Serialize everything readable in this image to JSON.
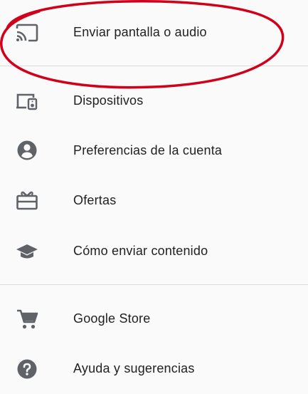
{
  "menu": {
    "items": [
      {
        "label": "Enviar pantalla o audio",
        "icon": "cast-icon"
      },
      {
        "label": "Dispositivos",
        "icon": "devices-icon"
      },
      {
        "label": "Preferencias de la cuenta",
        "icon": "account-circle-icon"
      },
      {
        "label": "Ofertas",
        "icon": "offers-gift-card-icon"
      },
      {
        "label": "Cómo enviar contenido",
        "icon": "school-cap-icon"
      },
      {
        "label": "Google Store",
        "icon": "shopping-cart-icon"
      },
      {
        "label": "Ayuda y sugerencias",
        "icon": "help-icon"
      }
    ]
  },
  "colors": {
    "background": "#fafafa",
    "text": "#212121",
    "icon": "#5f6368",
    "divider": "#dcdcdc",
    "annotation": "#d0021b"
  }
}
